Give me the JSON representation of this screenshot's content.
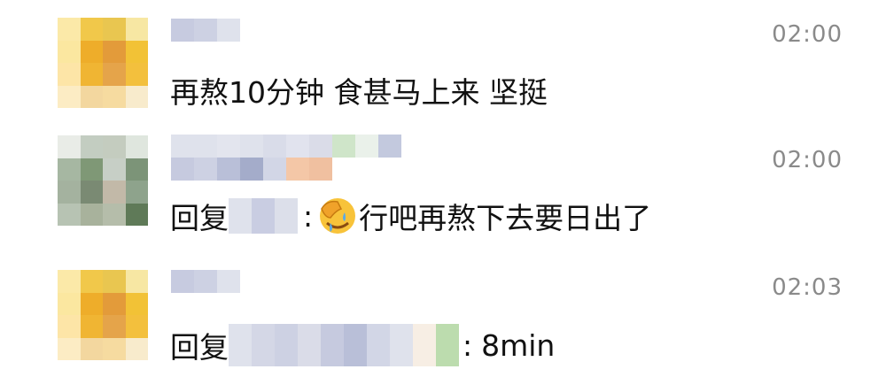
{
  "messages": [
    {
      "time": "02:00",
      "text": "再熬10分钟 食甚马上来 坚挺",
      "avatar_palette": [
        "#fbe9a8",
        "#f1c84a",
        "#e9c650",
        "#f7e7a3",
        "#fbe7a0",
        "#eead2a",
        "#e39b3a",
        "#f2c236",
        "#fde5a7",
        "#f0b533",
        "#e5a44a",
        "#f3c03d",
        "#fcecc4",
        "#f3d79f",
        "#f6dba0",
        "#f8ebcc"
      ],
      "name_palette": [
        "#c7cbe0",
        "#cdd1e3",
        "#dfe2ec"
      ]
    },
    {
      "time": "02:00",
      "prefix": "回复",
      "separator": ":",
      "text": "行吧再熬下去要日出了",
      "emoji": "face-palm-crying-emoji",
      "avatar_palette": [
        "#e9ece7",
        "#c3cdc1",
        "#c4ccbf",
        "#dfe6de",
        "#a6b7a2",
        "#7f9876",
        "#c7cfc6",
        "#7c9478",
        "#a4b29f",
        "#7a8a73",
        "#c2b9a8",
        "#8ea38c",
        "#b7c3b3",
        "#a8b29c",
        "#b5bdaa",
        "#5f7a58"
      ],
      "name_palette": [
        "#dfe2ec",
        "#dfe2ec",
        "#e3e5ee",
        "#dfe2ec",
        "#d9dce9",
        "#e1e3ee",
        "#dadce8",
        "#cfe5c9",
        "#eaf1ea",
        "#c3c9de",
        "#c6cadf",
        "#cdd1e3",
        "#b9bfd8",
        "#a4acca",
        "#d2d6e6",
        "#f4c7a7",
        "#f0c0a0"
      ],
      "reply_palette": [
        "#dfe2ec",
        "#c9cde2",
        "#dcdfea"
      ]
    },
    {
      "time": "02:03",
      "prefix": "回复",
      "separator": ":",
      "text": "8min",
      "avatar_palette": [
        "#fbe9a8",
        "#f1c84a",
        "#e9c650",
        "#f7e7a3",
        "#fbe7a0",
        "#eead2a",
        "#e39b3a",
        "#f2c236",
        "#fde5a7",
        "#f0b533",
        "#e5a44a",
        "#f3c03d",
        "#fcecc4",
        "#f3d79f",
        "#f6dba0",
        "#f8ebcc"
      ],
      "name_palette": [
        "#c7cbe0",
        "#cdd1e3",
        "#dfe2ec"
      ],
      "reply_palette": [
        "#dfe2ec",
        "#d4d7e6",
        "#cdd1e3",
        "#dadce8",
        "#c6cadf",
        "#b9bfd8",
        "#d2d6e6",
        "#dfe2ec",
        "#f7eee4",
        "#bcdcae"
      ]
    }
  ]
}
